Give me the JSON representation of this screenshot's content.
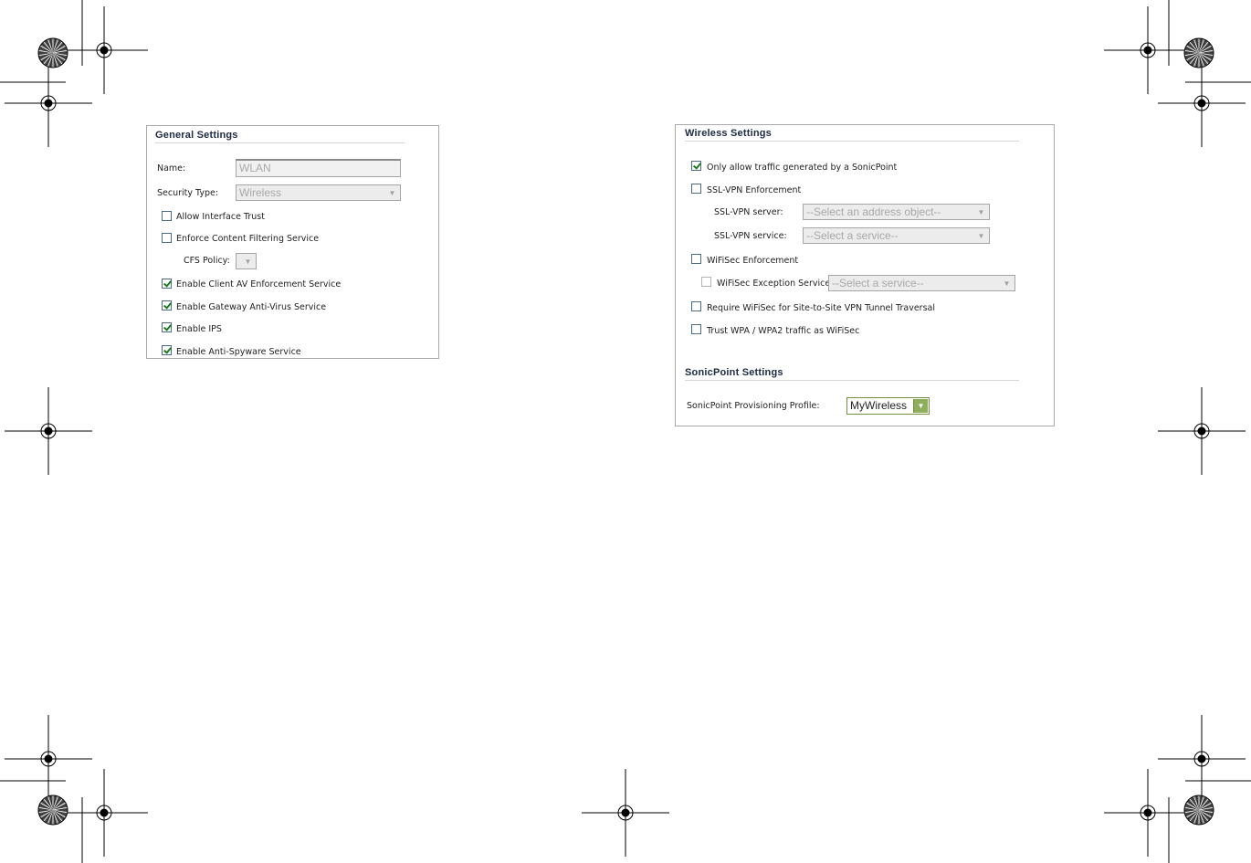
{
  "general": {
    "title": "General Settings",
    "name_label": "Name:",
    "name_value": "WLAN",
    "security_type_label": "Security Type:",
    "security_type_value": "Wireless",
    "allow_interface_trust": {
      "label": "Allow Interface Trust",
      "checked": false
    },
    "enforce_cfs": {
      "label": "Enforce Content Filtering Service",
      "checked": false
    },
    "cfs_policy_label": "CFS Policy:",
    "cfs_policy_value": "",
    "client_av": {
      "label": "Enable Client AV Enforcement Service",
      "checked": true
    },
    "gateway_av": {
      "label": "Enable Gateway Anti-Virus Service",
      "checked": true
    },
    "ips": {
      "label": "Enable IPS",
      "checked": true
    },
    "anti_spyware": {
      "label": "Enable Anti-Spyware Service",
      "checked": true
    }
  },
  "wireless": {
    "title": "Wireless Settings",
    "only_sonicpoint": {
      "label": "Only allow traffic generated by a SonicPoint",
      "checked": true
    },
    "sslvpn_enforcement": {
      "label": "SSL-VPN Enforcement",
      "checked": false
    },
    "sslvpn_server_label": "SSL-VPN server:",
    "sslvpn_server_value": "--Select an address object--",
    "sslvpn_service_label": "SSL-VPN service:",
    "sslvpn_service_value": "--Select a service--",
    "wifisec_enforcement": {
      "label": "WiFiSec Enforcement",
      "checked": false
    },
    "wifisec_exception": {
      "label": "WiFiSec Exception Service:",
      "checked": false
    },
    "wifisec_exception_value": "--Select a service--",
    "require_wifisec": {
      "label": "Require WiFiSec for Site-to-Site VPN Tunnel Traversal",
      "checked": false
    },
    "trust_wpa": {
      "label": "Trust WPA / WPA2 traffic as WiFiSec",
      "checked": false
    }
  },
  "sonicpoint": {
    "title": "SonicPoint Settings",
    "profile_label": "SonicPoint Provisioning Profile:",
    "profile_value": "MyWireless"
  },
  "colors": {
    "title_text": "#1c2a44",
    "check_green": "#1e7a1e",
    "select_accent": "#8fae5b"
  }
}
